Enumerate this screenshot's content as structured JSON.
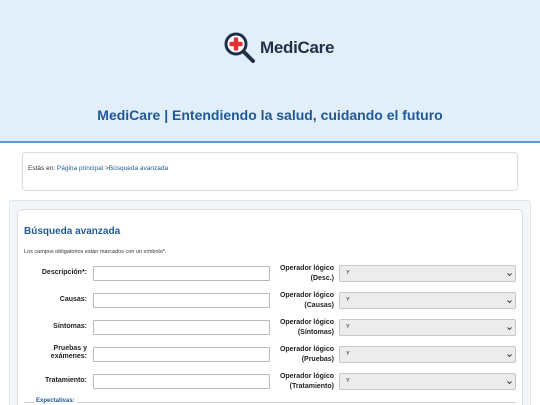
{
  "brand": {
    "logo_text": "MediCare",
    "tagline": "MediCare | Entendiendo la salud, cuidando el futuro"
  },
  "breadcrumb": {
    "prefix": "Estás en:",
    "home": "Página principal",
    "separator": ">",
    "current": "Búsqueda avanzada"
  },
  "search": {
    "title": "Búsqueda avanzada",
    "required_note": "Los campos obligatorios están marcados con un símbolo*.",
    "rows": [
      {
        "label": "Descripción*:",
        "op_label_1": "Operador lógico",
        "op_label_2": "(Desc.)",
        "op_value": "Y"
      },
      {
        "label": "Causas:",
        "op_label_1": "Operador lógico",
        "op_label_2": "(Causas)",
        "op_value": "Y"
      },
      {
        "label": "Síntomas:",
        "op_label_1": "Operador lógico",
        "op_label_2": "(Síntomas)",
        "op_value": "Y"
      },
      {
        "label_1": "Pruebas y",
        "label_2": "exámenes:",
        "op_label_1": "Operador lógico",
        "op_label_2": "(Pruebas)",
        "op_value": "Y"
      },
      {
        "label": "Tratamiento:",
        "op_label_1": "Operador lógico",
        "op_label_2": "(Tratamiento)",
        "op_value": "Y"
      }
    ],
    "expectations_legend": "Expectativas:"
  },
  "colors": {
    "header_bg": "#e2eef9",
    "accent": "#1f5a96",
    "logo_red": "#e03232"
  },
  "icons": {
    "logo": "magnifier-medical-cross-icon",
    "select_arrow": "chevron-down-icon"
  }
}
